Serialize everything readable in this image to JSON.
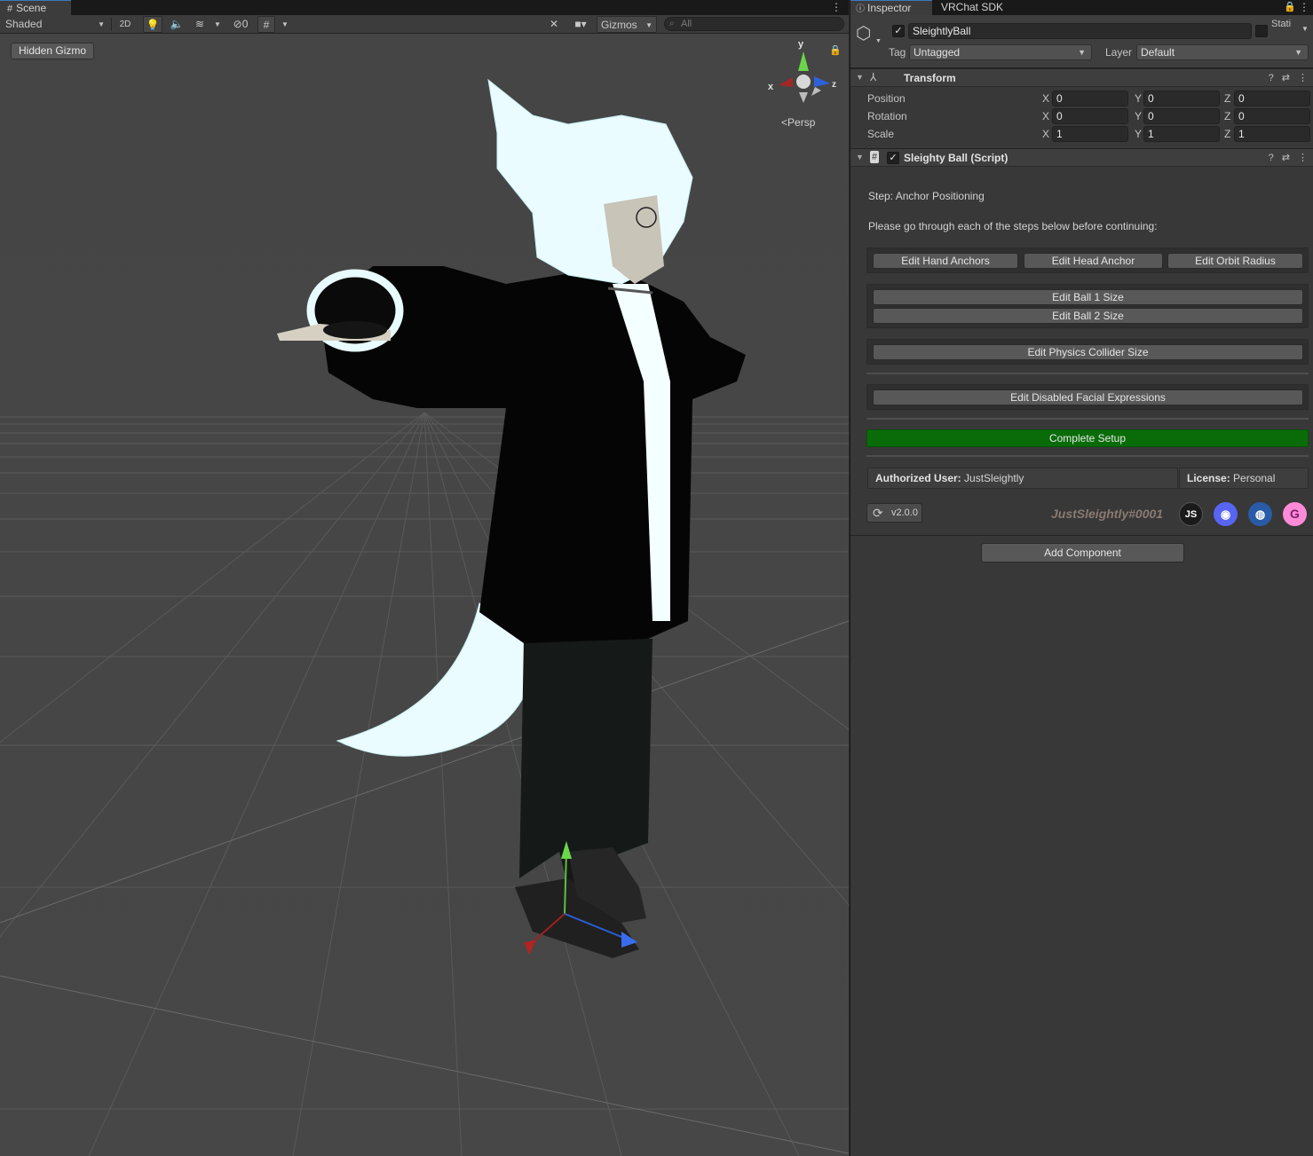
{
  "scene": {
    "tab_label": "Scene",
    "draw_mode": "Shaded",
    "btn_2d": "2D",
    "hidden_count": "0",
    "gizmos_label": "Gizmos",
    "search_placeholder": "All",
    "hidden_gizmo_label": "Hidden Gizmo",
    "projection_label": "Persp",
    "axis_y": "y",
    "axis_x": "x",
    "axis_z": "z"
  },
  "inspector": {
    "tabs": [
      "Inspector",
      "VRChat SDK"
    ],
    "object_name": "SleightlyBall",
    "static_label": "Stati",
    "tag_label": "Tag",
    "tag_value": "Untagged",
    "layer_label": "Layer",
    "layer_value": "Default",
    "transform": {
      "title": "Transform",
      "rows": [
        {
          "label": "Position",
          "x": "0",
          "y": "0",
          "z": "0"
        },
        {
          "label": "Rotation",
          "x": "0",
          "y": "0",
          "z": "0"
        },
        {
          "label": "Scale",
          "x": "1",
          "y": "1",
          "z": "1"
        }
      ],
      "axis_x": "X",
      "axis_y": "Y",
      "axis_z": "Z"
    },
    "script": {
      "title": "Sleighty Ball (Script)",
      "step_text": "Step: Anchor Positioning",
      "instruction_text": "Please go through each of the steps below before continuing:",
      "btn_hand_anchors": "Edit Hand Anchors",
      "btn_head_anchor": "Edit Head Anchor",
      "btn_orbit_radius": "Edit Orbit Radius",
      "btn_ball1_size": "Edit Ball 1 Size",
      "btn_ball2_size": "Edit Ball 2 Size",
      "btn_physics_collider": "Edit Physics Collider Size",
      "btn_disabled_facial": "Edit Disabled Facial Expressions",
      "btn_complete": "Complete Setup",
      "authorized_label": "Authorized User:",
      "authorized_value": "JustSleightly",
      "license_label": "License:",
      "license_value": "Personal",
      "version": "v2.0.0",
      "handle": "JustSleightly#0001"
    },
    "add_component": "Add Component"
  },
  "colors": {
    "scene_bg": "#474747",
    "inspector_bg": "#383838",
    "complete_green": "#096c09",
    "selection_blue": "#3a79bb"
  }
}
